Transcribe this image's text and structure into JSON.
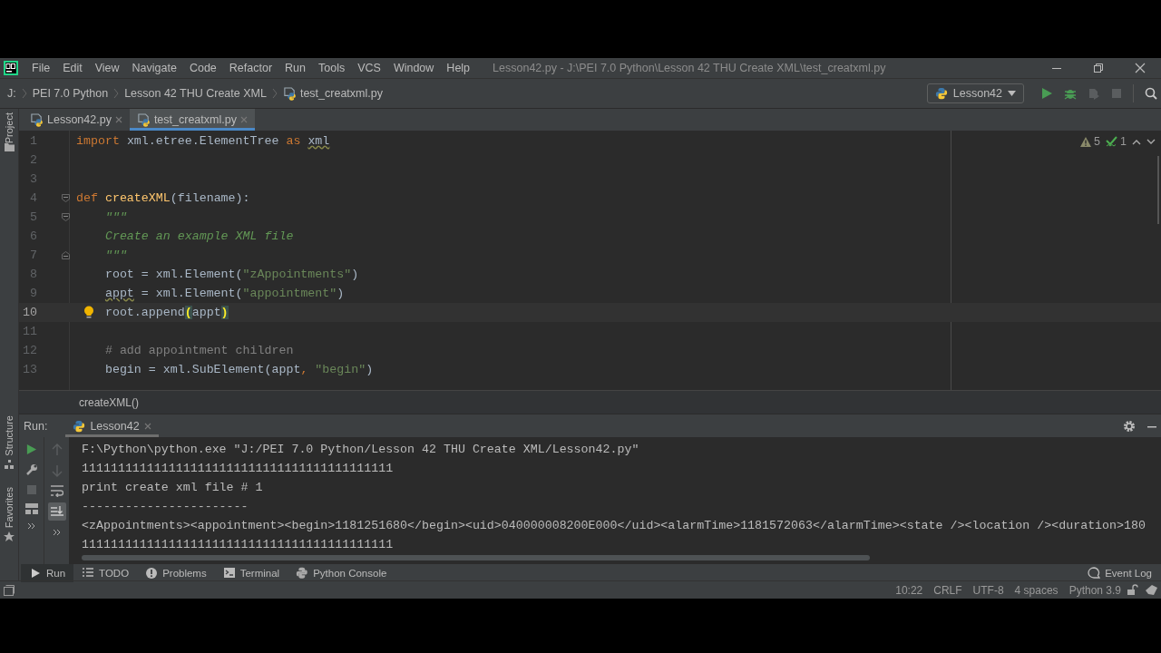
{
  "menu": [
    "File",
    "Edit",
    "View",
    "Navigate",
    "Code",
    "Refactor",
    "Run",
    "Tools",
    "VCS",
    "Window",
    "Help"
  ],
  "window": {
    "title": "Lesson42.py - J:\\PEI 7.0 Python\\Lesson 42 THU Create XML\\test_creatxml.py"
  },
  "breadcrumb": [
    "J:",
    "PEI 7.0 Python",
    "Lesson 42 THU Create XML",
    "test_creatxml.py"
  ],
  "run_config": "Lesson42",
  "side_labels": [
    "Project",
    "Structure",
    "Favorites"
  ],
  "tabs": [
    {
      "label": "Lesson42.py",
      "selected": false
    },
    {
      "label": "test_creatxml.py",
      "selected": true
    }
  ],
  "inspections": {
    "warnings": "5",
    "typos": "1"
  },
  "editor": {
    "lines": [
      {
        "number": "1",
        "kind": "plain",
        "selected": false,
        "bulb": false,
        "tokens": [
          {
            "kind": "kw",
            "text": "import"
          },
          {
            "kind": "plain",
            "text": " xml.etree.ElementTree "
          },
          {
            "kind": "kw",
            "text": "as"
          },
          {
            "kind": "squiggle",
            "text": " xml"
          }
        ]
      },
      {
        "number": "2",
        "kind": "plain",
        "selected": false,
        "bulb": false
      },
      {
        "number": "3",
        "kind": "plain",
        "selected": false,
        "bulb": false
      },
      {
        "number": "4",
        "kind": "fold_start",
        "selected": false,
        "bulb": false,
        "tokens": [
          {
            "kind": "kw",
            "text": "def "
          },
          {
            "kind": "fn",
            "text": "createXML"
          },
          {
            "kind": "plain",
            "text": "(filename):"
          }
        ]
      },
      {
        "number": "5",
        "kind": "fold_start",
        "selected": false,
        "bulb": false,
        "tokens": [
          {
            "kind": "doc",
            "text": "    \"\"\""
          }
        ]
      },
      {
        "number": "6",
        "kind": "plain",
        "selected": false,
        "bulb": false,
        "tokens": [
          {
            "kind": "doc",
            "text": "    Create an example XML file"
          }
        ]
      },
      {
        "number": "7",
        "kind": "fold_end",
        "selected": false,
        "bulb": false,
        "tokens": [
          {
            "kind": "doc",
            "text": "    \"\"\""
          }
        ]
      },
      {
        "number": "8",
        "kind": "plain",
        "selected": false,
        "bulb": false,
        "tokens": [
          {
            "kind": "plain",
            "text": "    root = xml.Element("
          },
          {
            "kind": "str",
            "text": "\"zAppointments\""
          },
          {
            "kind": "plain",
            "text": ")"
          }
        ]
      },
      {
        "number": "9",
        "kind": "plain",
        "selected": false,
        "bulb": false,
        "tokens": [
          {
            "kind": "squiggle",
            "text": "    appt"
          },
          {
            "kind": "plain",
            "text": " = xml.Element("
          },
          {
            "kind": "str",
            "text": "\"appointment\""
          },
          {
            "kind": "plain",
            "text": ")"
          }
        ]
      },
      {
        "number": "10",
        "kind": "plain",
        "selected": true,
        "bulb": true,
        "tokens": [
          {
            "kind": "plain",
            "text": "    root.append"
          },
          {
            "kind": "match",
            "text": "("
          },
          {
            "kind": "plain",
            "text": "appt"
          },
          {
            "kind": "match",
            "text": ")"
          }
        ]
      },
      {
        "number": "11",
        "kind": "plain",
        "selected": false,
        "bulb": false
      },
      {
        "number": "12",
        "kind": "plain",
        "selected": false,
        "bulb": false,
        "tokens": [
          {
            "kind": "comment",
            "text": "    # add appointment children"
          }
        ]
      },
      {
        "number": "13",
        "kind": "plain",
        "selected": false,
        "bulb": false,
        "tokens": [
          {
            "kind": "plain",
            "text": "    begin = xml.SubElement(appt"
          },
          {
            "kind": "comma",
            "text": ", "
          },
          {
            "kind": "str",
            "text": "\"begin\""
          },
          {
            "kind": "plain",
            "text": ")"
          }
        ]
      }
    ]
  },
  "editor_breadcrumb": "createXML()",
  "run_panel": {
    "label": "Run:",
    "tab": "Lesson42",
    "output": [
      "F:\\Python\\python.exe \"J:/PEI 7.0 Python/Lesson 42 THU Create XML/Lesson42.py\"",
      "1111111111111111111111111111111111111111111",
      "print create xml file # 1",
      "-----------------------",
      "<zAppointments><appointment><begin>1181251680</begin><uid>040000008200E000</uid><alarmTime>1181572063</alarmTime><state /><location /><duration>180",
      "1111111111111111111111111111111111111111111"
    ]
  },
  "tool_tabs": [
    {
      "kind": "run",
      "label": "Run",
      "selected": true
    },
    {
      "kind": "todo",
      "label": "TODO",
      "selected": false
    },
    {
      "kind": "problems",
      "label": "Problems",
      "selected": false
    },
    {
      "kind": "terminal",
      "label": "Terminal",
      "selected": false
    },
    {
      "kind": "console",
      "label": "Python Console",
      "selected": false
    }
  ],
  "event_log": "Event Log",
  "status": [
    "10:22",
    "CRLF",
    "UTF-8",
    "4 spaces",
    "Python 3.9"
  ]
}
